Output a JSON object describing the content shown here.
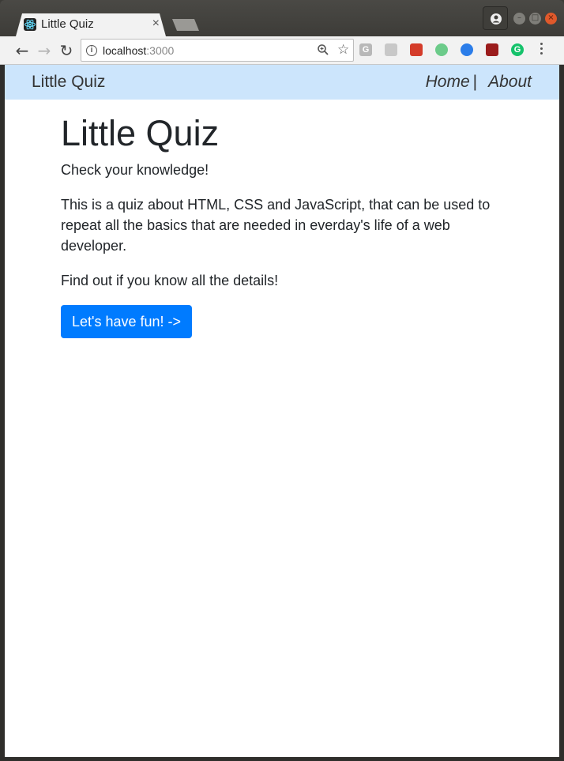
{
  "browser": {
    "tab_title": "Little Quiz",
    "tab_close": "×",
    "url_host": "localhost",
    "url_port": ":3000",
    "back_glyph": "←",
    "forward_glyph": "→",
    "reload_glyph": "↻",
    "star_glyph": "☆",
    "window_controls": {
      "minimize": "–",
      "maximize": "□",
      "close": "×"
    },
    "extensions": [
      {
        "name": "g-extension-icon",
        "color": "#b8b8b8",
        "label": "G"
      },
      {
        "name": "book-extension-icon",
        "color": "#c8c8c8",
        "label": ""
      },
      {
        "name": "red-extension-icon",
        "color": "#d43c2a",
        "label": ""
      },
      {
        "name": "target-extension-icon",
        "color": "#6ccb8a",
        "label": ""
      },
      {
        "name": "color-wheel-extension-icon",
        "color": "#2b7de9",
        "label": ""
      },
      {
        "name": "diamond-extension-icon",
        "color": "#9b1c1c",
        "label": ""
      },
      {
        "name": "grammarly-extension-icon",
        "color": "#15c26b",
        "label": "G"
      }
    ]
  },
  "navbar": {
    "brand": "Little Quiz",
    "home": "Home",
    "separator": "|",
    "about": "About",
    "background": "#cce5fc"
  },
  "main": {
    "title": "Little Quiz",
    "subtitle": "Check your knowledge!",
    "description": "This is a quiz about HTML, CSS and JavaScript, that can be used to repeat all the basics that are needed in everday's life of a web developer.",
    "cta_text": "Find out if you know all the details!",
    "button_label": "Let's have fun! ->",
    "button_color": "#007bff"
  }
}
